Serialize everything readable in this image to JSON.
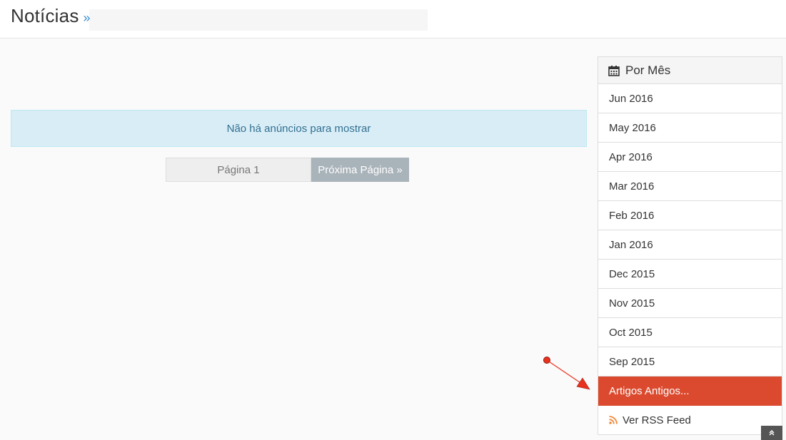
{
  "header": {
    "title": "Notícias",
    "chevron": "»"
  },
  "main": {
    "alert_text": "Não há anúncios para mostrar",
    "pager": {
      "current": "Página 1",
      "next": "Próxima Página »"
    }
  },
  "sidebar": {
    "heading": "Por Mês",
    "heading_icon": "calendar-icon",
    "months": [
      {
        "label": "Jun 2016"
      },
      {
        "label": "May 2016"
      },
      {
        "label": "Apr 2016"
      },
      {
        "label": "Mar 2016"
      },
      {
        "label": "Feb 2016"
      },
      {
        "label": "Jan 2016"
      },
      {
        "label": "Dec 2015"
      },
      {
        "label": "Nov 2015"
      },
      {
        "label": "Oct 2015"
      },
      {
        "label": "Sep 2015"
      }
    ],
    "older": "Artigos Antigos...",
    "rss": "Ver RSS Feed",
    "rss_icon": "rss-icon"
  },
  "colors": {
    "accent_red": "#db4a2e",
    "alert_bg": "#d9edf7",
    "alert_text": "#31708f",
    "pager_next_bg": "#a9b3ba",
    "rss_orange": "#f0883a"
  },
  "scroll_top_icon": "double-chevron-up-icon"
}
